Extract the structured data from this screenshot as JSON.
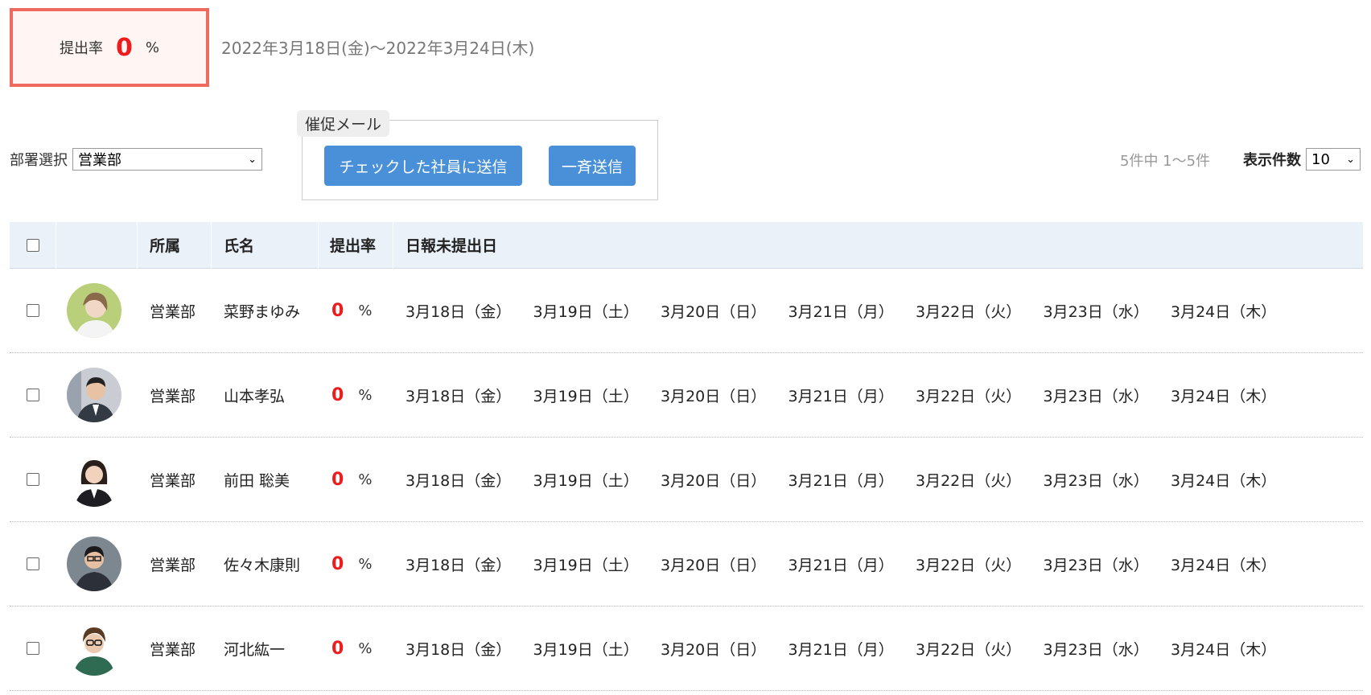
{
  "summary": {
    "rate_label": "提出率",
    "rate_value": "0",
    "rate_unit": "%",
    "period": "2022年3月18日(金)〜2022年3月24日(木)"
  },
  "filter": {
    "dept_label": "部署選択",
    "dept_selected": "営業部"
  },
  "mail": {
    "legend": "催促メール",
    "send_checked_label": "チェックした社員に送信",
    "send_all_label": "一斉送信"
  },
  "paging": {
    "count_text": "5件中 1〜5件",
    "per_page_label": "表示件数",
    "per_page_value": "10"
  },
  "table": {
    "headers": {
      "dept": "所属",
      "name": "氏名",
      "rate": "提出率",
      "dates": "日報未提出日"
    },
    "rows": [
      {
        "dept": "営業部",
        "name": "菜野まゆみ",
        "rate": "0",
        "unit": "%",
        "dates": [
          "3月18日（金）",
          "3月19日（土）",
          "3月20日（日）",
          "3月21日（月）",
          "3月22日（火）",
          "3月23日（水）",
          "3月24日（木）"
        ]
      },
      {
        "dept": "営業部",
        "name": "山本孝弘",
        "rate": "0",
        "unit": "%",
        "dates": [
          "3月18日（金）",
          "3月19日（土）",
          "3月20日（日）",
          "3月21日（月）",
          "3月22日（火）",
          "3月23日（水）",
          "3月24日（木）"
        ]
      },
      {
        "dept": "営業部",
        "name": "前田 聡美",
        "rate": "0",
        "unit": "%",
        "dates": [
          "3月18日（金）",
          "3月19日（土）",
          "3月20日（日）",
          "3月21日（月）",
          "3月22日（火）",
          "3月23日（水）",
          "3月24日（木）"
        ]
      },
      {
        "dept": "営業部",
        "name": "佐々木康則",
        "rate": "0",
        "unit": "%",
        "dates": [
          "3月18日（金）",
          "3月19日（土）",
          "3月20日（日）",
          "3月21日（月）",
          "3月22日（火）",
          "3月23日（水）",
          "3月24日（木）"
        ]
      },
      {
        "dept": "営業部",
        "name": "河北紘一",
        "rate": "0",
        "unit": "%",
        "dates": [
          "3月18日（金）",
          "3月19日（土）",
          "3月20日（日）",
          "3月21日（月）",
          "3月22日（火）",
          "3月23日（水）",
          "3月24日（木）"
        ]
      }
    ]
  },
  "colors": {
    "accent_button": "#4a90d9",
    "rate_red": "#ee1c1c",
    "summary_border": "#ef6a5f",
    "header_bg": "#ebf1f9"
  }
}
